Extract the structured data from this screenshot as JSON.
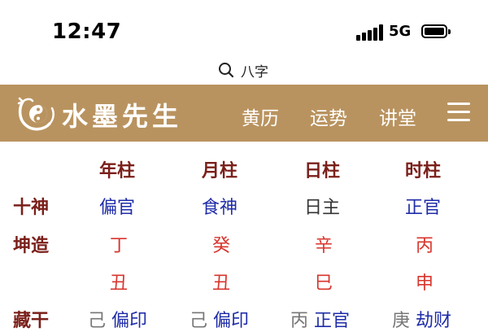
{
  "status_bar": {
    "time": "12:47",
    "network": "5G"
  },
  "search": {
    "icon": "search-icon",
    "text": "八字"
  },
  "header": {
    "brand": "水墨先生",
    "nav": [
      "黄历",
      "运势",
      "讲堂"
    ],
    "menu_icon": "hamburger-menu-icon"
  },
  "table": {
    "columns": [
      "年柱",
      "月柱",
      "日柱",
      "时柱"
    ],
    "rows": {
      "shishen": {
        "label": "十神",
        "values": [
          "偏官",
          "食神",
          "日主",
          "正官"
        ]
      },
      "kunzao": {
        "label": "坤造",
        "stems": [
          "丁",
          "癸",
          "辛",
          "丙"
        ],
        "branches": [
          "丑",
          "丑",
          "巳",
          "申"
        ]
      },
      "canggan": {
        "label": "藏干",
        "items": [
          {
            "stem": "己",
            "god": "偏印"
          },
          {
            "stem": "己",
            "god": "偏印"
          },
          {
            "stem": "丙",
            "god": "正官"
          },
          {
            "stem": "庚",
            "god": "劫财"
          }
        ]
      }
    }
  },
  "colors": {
    "header_bg": "#b9935f",
    "label_red": "#7a1f1a",
    "god_blue": "#1f2ca8",
    "stem_red": "#d8352d"
  }
}
